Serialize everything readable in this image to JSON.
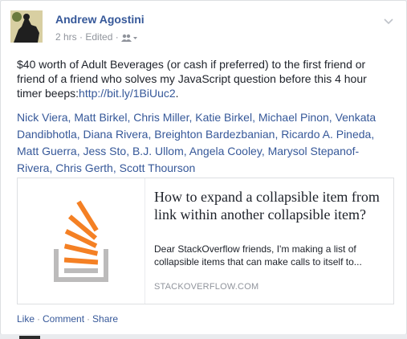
{
  "post": {
    "author": "Andrew Agostini",
    "time": "2 hrs",
    "edited": "Edited",
    "privacy_icon": "friends-icon",
    "body_prefix": "$40 worth of Adult Beverages (or cash if preferred) to the first friend or friend of a friend who solves my JavaScript question before this 4 hour timer beeps:",
    "body_link": "http://bit.ly/1BiUuc2",
    "body_suffix": "."
  },
  "tags": [
    "Nick Viera",
    "Matt Birkel",
    "Chris Miller",
    "Katie Birkel",
    "Michael Pinon",
    "Venkata Dandibhotla",
    "Diana Rivera",
    "Breighton Bardezbanian",
    "Ricardo A. Pineda",
    "Matt Guerra",
    "Jess Sto",
    "B.J. Ullom",
    "Angela Cooley",
    "Marysol Stepanof-Rivera",
    "Chris Gerth",
    "Scott Thourson"
  ],
  "link_preview": {
    "title": "How to expand a collapsible item from link within another collapsible item?",
    "description": "Dear StackOverflow friends, I'm making a list of collapsible items that can make calls to itself to...",
    "domain": "STACKOVERFLOW.COM",
    "thumb_icon": "stackoverflow-logo-icon"
  },
  "actions": {
    "like": "Like",
    "comment": "Comment",
    "share": "Share",
    "separator": "·"
  }
}
